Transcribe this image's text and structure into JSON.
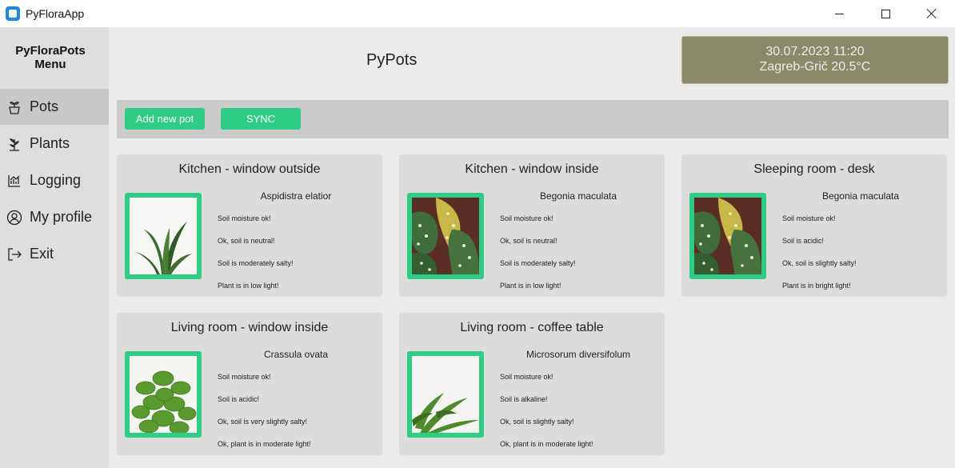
{
  "window": {
    "title": "PyFloraApp"
  },
  "sidebar": {
    "title": "PyFloraPots Menu",
    "items": [
      {
        "label": "Pots",
        "icon": "pot-icon"
      },
      {
        "label": "Plants",
        "icon": "plant-icon"
      },
      {
        "label": "Logging",
        "icon": "chart-icon"
      },
      {
        "label": "My profile",
        "icon": "user-icon"
      },
      {
        "label": "Exit",
        "icon": "exit-icon"
      }
    ]
  },
  "header": {
    "title": "PyPots",
    "datetime": "30.07.2023 11:20",
    "weather": "Zagreb-Grič 20.5°C"
  },
  "toolbar": {
    "add_label": "Add new pot",
    "sync_label": "SYNC"
  },
  "colors": {
    "accent": "#2ecc84",
    "weather_bg": "#8b8a68",
    "sidebar_bg": "#dedede"
  },
  "pots": [
    {
      "title": "Kitchen - window outside",
      "plant": "Aspidistra elatior",
      "status": [
        "Soil moisture ok!",
        "Ok, soil is neutral!",
        "Soil is moderately salty!",
        "Plant is in low light!"
      ]
    },
    {
      "title": "Kitchen - window inside",
      "plant": "Begonia maculata",
      "status": [
        "Soil moisture ok!",
        "Ok, soil is neutral!",
        "Soil is moderately salty!",
        "Plant is in low light!"
      ]
    },
    {
      "title": "Sleeping room - desk",
      "plant": "Begonia maculata",
      "status": [
        "Soil moisture ok!",
        "Soil is acidic!",
        "Ok, soil is slightly salty!",
        "Plant is in bright light!"
      ]
    },
    {
      "title": "Living room - window inside",
      "plant": "Crassula ovata",
      "status": [
        "Soil moisture ok!",
        "Soil is acidic!",
        "Ok, soil is very slightly salty!",
        "Ok, plant is in moderate light!"
      ]
    },
    {
      "title": "Living room - coffee table",
      "plant": "Microsorum diversifolum",
      "status": [
        "Soil moisture ok!",
        "Soil is alkaline!",
        "Ok, soil is slightly salty!",
        "Ok, plant is in moderate light!"
      ]
    }
  ]
}
